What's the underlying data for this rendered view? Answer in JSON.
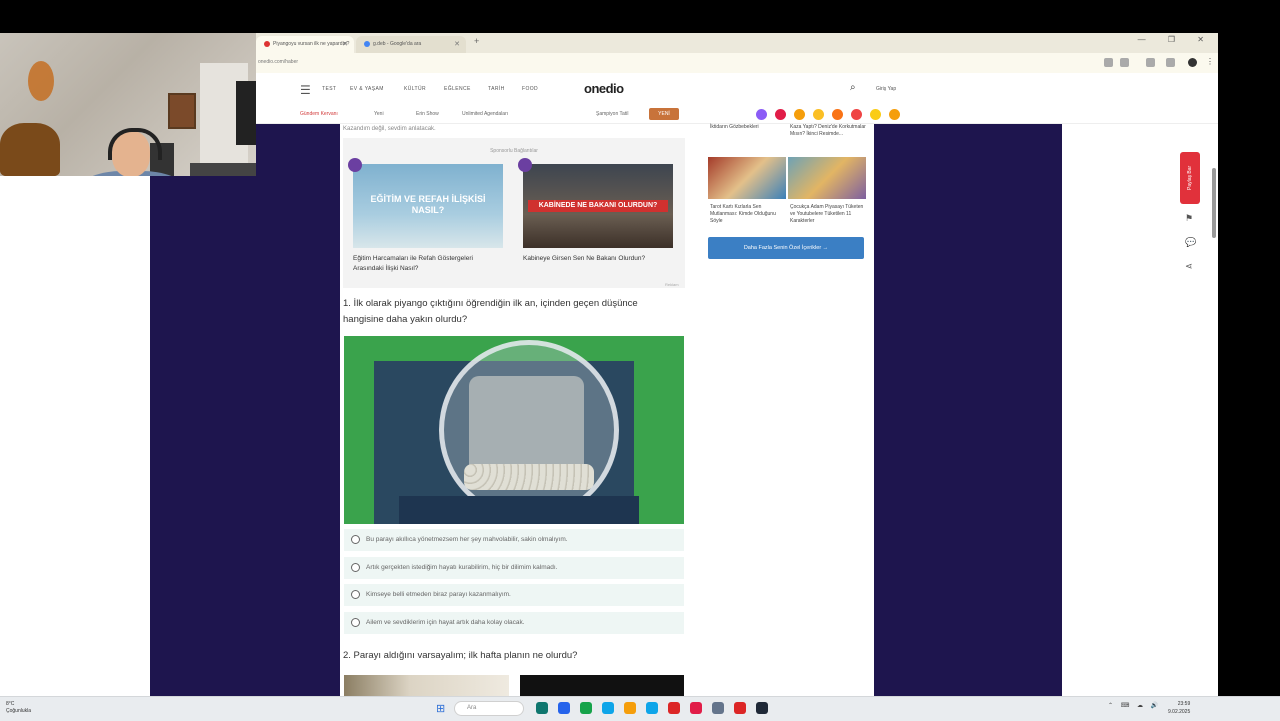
{
  "browser": {
    "tabs": [
      {
        "label": "Piyangoyu vursan ilk ne yapardın?"
      },
      {
        "label": "g.deb - Google'da ara"
      }
    ],
    "new_tab": "+",
    "window_controls": "— ❐ ✕",
    "url": "onedio.com/haber"
  },
  "site": {
    "logo": "onedio",
    "nav": [
      "TEST",
      "EV & YAŞAM",
      "KÜLTÜR",
      "EĞLENCE",
      "TARİH",
      "FOOD"
    ],
    "sign_in": "Giriş Yap",
    "subbar": {
      "hot": "Gündem Kervanı",
      "items": [
        "Yeni",
        "Erin Show",
        "Unlimited Agendaları",
        "Şampiyon Tatil"
      ],
      "new_badge": "YENİ"
    },
    "emojis": [
      "#8b5cf6",
      "#e11d48",
      "#f59e0b",
      "#fbbf24",
      "#f97316",
      "#ef4444",
      "#facc15",
      "#f59e0b"
    ]
  },
  "article": {
    "cut_text": "Kazandım değil, sevdim anlatacak.",
    "related": {
      "heading": "Sponsorlu Bağlantılar",
      "items": [
        {
          "image_title": "EĞİTİM VE REFAH İLİŞKİSİ NASIL?",
          "caption": "Eğitim Harcamaları ile Refah Göstergeleri Arasındaki İlişki Nasıl?"
        },
        {
          "image_title": "KABİNEDE NE BAKANI OLURDUN?",
          "caption": "Kabineye Girsen Sen Ne Bakanı Olurdun?"
        }
      ],
      "ad_tag": "Reklam"
    },
    "q1": {
      "title": "1. İlk olarak piyango çıktığını öğrendiğin ilk an, içinden geçen düşünce hangisine daha yakın olurdu?",
      "options": [
        "Bu parayı akıllıca yönetmezsem her şey mahvolabilir, sakin olmalıyım.",
        "Artık gerçekten istediğim hayatı kurabilirim, hiç bir dilimim kalmadı.",
        "Kimseye belli etmeden biraz parayı kazanmalıyım.",
        "Ailem ve sevdiklerim için hayat artık daha kolay olacak."
      ]
    },
    "q2": {
      "title": "2. Parayı aldığını varsayalım; ilk hafta planın ne olurdu?"
    }
  },
  "sidebar": {
    "top_1": "İktidarın Gözbebekleri",
    "top_2": "Kaza Yaptı? Deniz'de Korkutmalar Mısın? İkinci Resimde...",
    "cap_1": "Tarot Kartı Kızlarla Sen Mutlanması: Kimde Olduğunu Söyle",
    "cap_2": "Çocukça Adam Piyasayı Tüketen ve Youtubelere Tüketilen 11 Karakterler",
    "more_button": "Daha Fazla Senin Özel İçerikler →"
  },
  "rail": {
    "share_tab": "Paylaş Bar",
    "bookmark": "⚑",
    "comment": "💬",
    "share": "⋖"
  },
  "taskbar": {
    "weather": "8°C\nÇoğunlukla",
    "search": "Ara",
    "start": "⊞",
    "clock_time": "23:59",
    "clock_date": "9.02.2025",
    "tray": "⌃ ⌨ ☁ 🔊",
    "app_colors": [
      "#0f766e",
      "#2563eb",
      "#16a34a",
      "#0ea5e9",
      "#f59e0b",
      "#0ea5e9",
      "#dc2626",
      "#e11d48",
      "#64748b",
      "#dc2626",
      "#1f2937"
    ]
  }
}
